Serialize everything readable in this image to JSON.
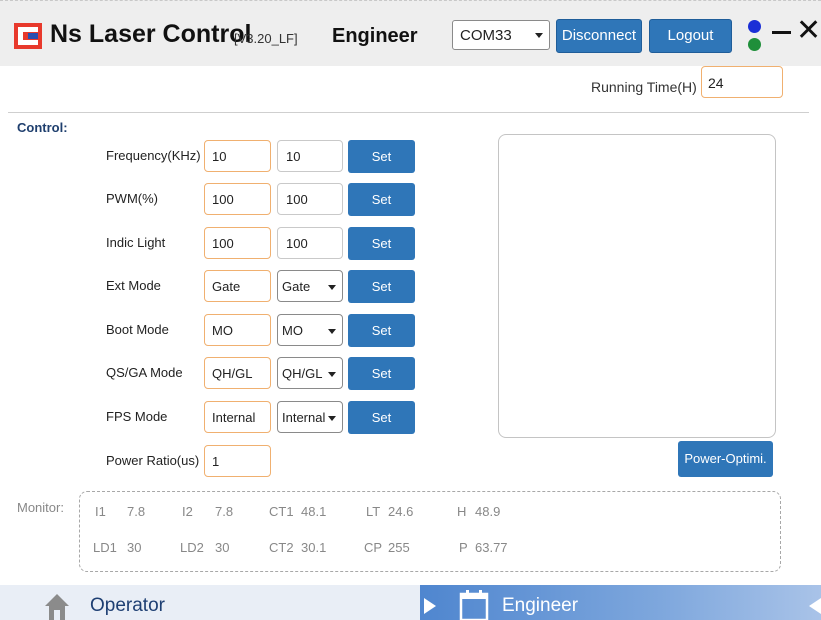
{
  "header": {
    "title": "Ns Laser Control",
    "version": "[V3.20_LF]",
    "role": "Engineer",
    "com_port": "COM33",
    "disconnect_label": "Disconnect",
    "logout_label": "Logout",
    "minimize_glyph": "—",
    "close_glyph": "✕",
    "status_colors": {
      "blue": "#1b2fd6",
      "green": "#1f8f3a"
    },
    "logo_colors": {
      "red": "#e8392c",
      "blue": "#2b4fb0"
    }
  },
  "running_time": {
    "label": "Running Time(H)",
    "value": "24"
  },
  "control": {
    "label": "Control:",
    "set_label": "Set",
    "rows": [
      {
        "label": "Frequency(KHz)",
        "current": "10",
        "input": "10",
        "input_type": "text"
      },
      {
        "label": "PWM(%)",
        "current": "100",
        "input": "100",
        "input_type": "text"
      },
      {
        "label": "Indic Light",
        "current": "100",
        "input": "100",
        "input_type": "text"
      },
      {
        "label": "Ext Mode",
        "current": "Gate",
        "input": "Gate",
        "input_type": "select"
      },
      {
        "label": "Boot Mode",
        "current": "MO",
        "input": "MO",
        "input_type": "select"
      },
      {
        "label": "QS/GA Mode",
        "current": "QH/GL",
        "input": "QH/GL",
        "input_type": "select"
      },
      {
        "label": "FPS Mode",
        "current": "Internal",
        "input": "Internal",
        "input_type": "select"
      }
    ],
    "power_ratio": {
      "label": "Power Ratio(us)",
      "value": "1"
    },
    "power_optimize_label": "Power-Optimi."
  },
  "monitor": {
    "label": "Monitor:",
    "row1": [
      {
        "key": "I1",
        "value": "7.8"
      },
      {
        "key": "I2",
        "value": "7.8"
      },
      {
        "key": "CT1",
        "value": "48.1"
      },
      {
        "key": "LT",
        "value": "24.6"
      },
      {
        "key": "H",
        "value": "48.9"
      }
    ],
    "row2": [
      {
        "key": "LD1",
        "value": "30"
      },
      {
        "key": "LD2",
        "value": "30"
      },
      {
        "key": "CT2",
        "value": "30.1"
      },
      {
        "key": "CP",
        "value": "255"
      },
      {
        "key": "P",
        "value": "63.77"
      }
    ]
  },
  "nav": {
    "operator_label": "Operator",
    "engineer_label": "Engineer",
    "operator_icon": "home-icon",
    "engineer_icon": "engineer-icon"
  },
  "theme": {
    "accent": "#2f76b8",
    "input_border": "#f0b070"
  }
}
